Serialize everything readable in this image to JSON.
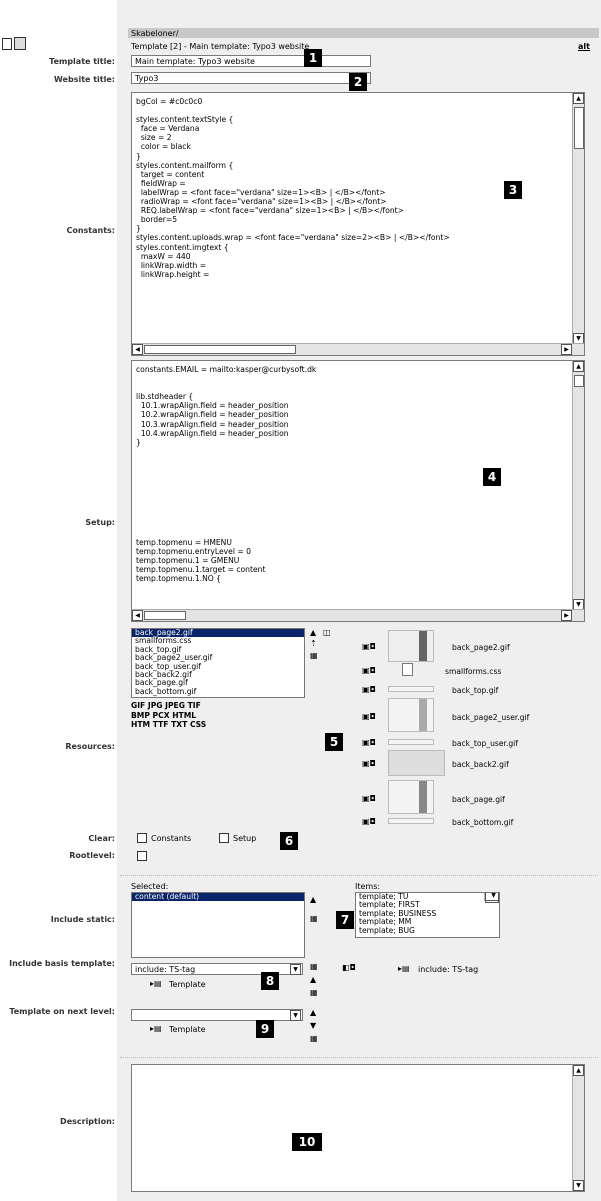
{
  "header": {
    "path_label": "Skabeloner/",
    "template_line": "Template [2] - Main template: Typo3 website",
    "right_link": "alt"
  },
  "labels": {
    "template_title": "Template title:",
    "website_title": "Website title:",
    "constants": "Constants:",
    "setup": "Setup:",
    "resources": "Resources:",
    "clear": "Clear:",
    "rootlevel": "Rootlevel:",
    "include_static": "Include static:",
    "include_basis": "Include basis template:",
    "template_next": "Template on next level:",
    "description": "Description:"
  },
  "fields": {
    "template_title": "Main template: Typo3 website",
    "website_title": "Typo3"
  },
  "constants_text": "bgCol = #c0c0c0\n\nstyles.content.textStyle {\n  face = Verdana\n  size = 2\n  color = black\n}\nstyles.content.mailform {\n  target = content\n  fieldWrap =\n  labelWrap = <font face=\"verdana\" size=1><B> | </B></font>\n  radioWrap = <font face=\"verdana\" size=1><B> | </B></font>\n  REQ.labelWrap = <font face=\"verdana\" size=1><B> | </B></font>\n  border=5\n}\nstyles.content.uploads.wrap = <font face=\"verdana\" size=2><B> | </B></font>\nstyles.content.imgtext {\n  maxW = 440\n  linkWrap.width =\n  linkWrap.height =",
  "setup_text": "constants.EMAIL = mailto:kasper@curbysoft.dk\n\n\nlib.stdheader {\n  10.1.wrapAlign.field = header_position\n  10.2.wrapAlign.field = header_position\n  10.3.wrapAlign.field = header_position\n  10.4.wrapAlign.field = header_position\n}\n\n\n\n\n\n\n\n\n\n\ntemp.topmenu = HMENU\ntemp.topmenu.entryLevel = 0\ntemp.topmenu.1 = GMENU\ntemp.topmenu.1.target = content\ntemp.topmenu.1.NO {",
  "resources": {
    "files": [
      "back_page2.gif",
      "smallforms.css",
      "back_top.gif",
      "back_page2_user.gif",
      "back_top_user.gif",
      "back_back2.gif",
      "back_page.gif",
      "back_bottom.gif"
    ],
    "allowed_types": "GIF JPG JPEG TIF\nBMP PCX HTML\nHTM TTF TXT CSS"
  },
  "clear": {
    "constants_label": "Constants",
    "setup_label": "Setup"
  },
  "include_static": {
    "selected_label": "Selected:",
    "items_label": "Items:",
    "selected": [
      "content (default)"
    ],
    "items": [
      "template; TU",
      "template; FIRST",
      "template; BUSINESS",
      "template; MM",
      "template; BUG"
    ]
  },
  "include_basis": {
    "select_value": "include: TS-tag",
    "template_link": "Template",
    "side_value": "include: TS-tag"
  },
  "template_next": {
    "select_value": "",
    "template_link": "Template"
  },
  "markers": [
    "1",
    "2",
    "3",
    "4",
    "5",
    "6",
    "7",
    "8",
    "9",
    "10"
  ]
}
